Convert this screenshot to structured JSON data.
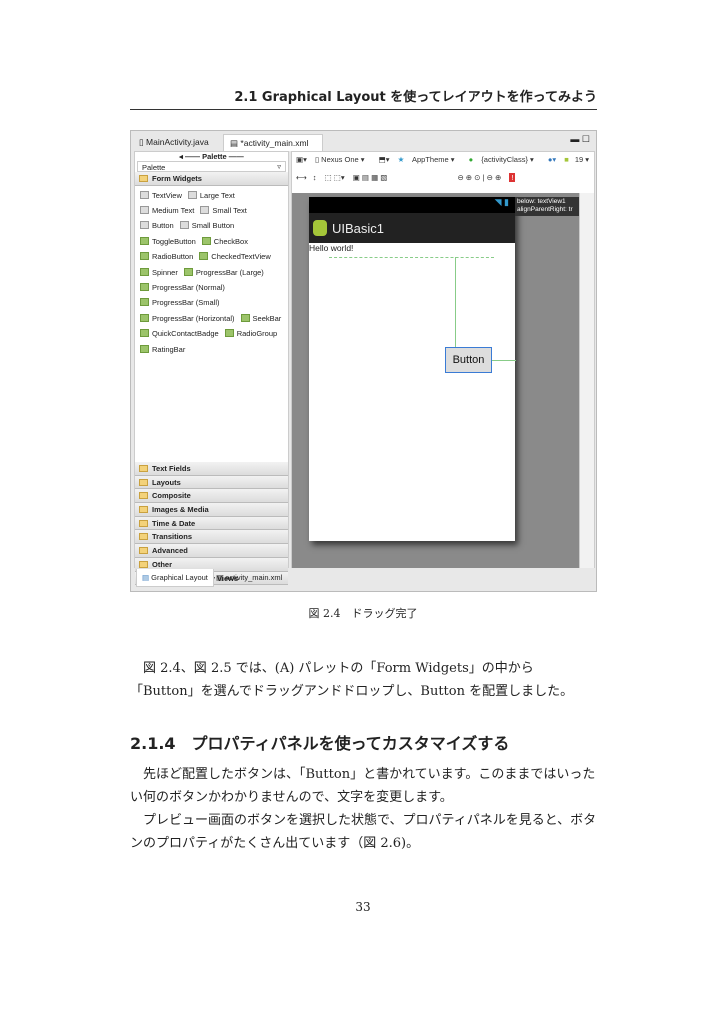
{
  "running_header": "2.1 Graphical Layout を使ってレイアウトを作ってみよう",
  "screenshot": {
    "tabs": [
      "MainActivity.java",
      "*activity_main.xml"
    ],
    "palette": {
      "title": "Palette",
      "select": "Palette",
      "open_category": "Form Widgets",
      "widget_rows": [
        [
          "TextView",
          "Large Text"
        ],
        [
          "Medium Text",
          "Small Text"
        ],
        [
          "Button",
          "Small Button"
        ],
        [
          "ToggleButton",
          "CheckBox"
        ],
        [
          "RadioButton",
          "CheckedTextView"
        ],
        [
          "Spinner",
          "ProgressBar (Large)"
        ],
        [
          "ProgressBar (Normal)"
        ],
        [
          "ProgressBar (Small)"
        ],
        [
          "ProgressBar (Horizontal)",
          "SeekBar"
        ],
        [
          "QuickContactBadge",
          "RadioGroup"
        ],
        [
          "RatingBar"
        ]
      ],
      "categories": [
        "Text Fields",
        "Layouts",
        "Composite",
        "Images & Media",
        "Time & Date",
        "Transitions",
        "Advanced",
        "Other",
        "Custom & Library Views"
      ]
    },
    "toolbar": {
      "device": "Nexus One ▾",
      "theme": "AppTheme ▾",
      "activity": "{activityClass} ▾",
      "api": "19 ▾"
    },
    "preview": {
      "app_title": "UIBasic1",
      "hello": "Hello world!",
      "button": "Button",
      "tooltip": [
        "below: textView1",
        "alignParentRight: tr"
      ]
    },
    "bottom_tabs": [
      "Graphical Layout",
      "activity_main.xml"
    ]
  },
  "caption": "図 2.4　ドラッグ完了",
  "para1": "図 2.4、図 2.5 では、(A) パレットの「Form Widgets」の中から「Button」を選んでドラッグアンドドロップし、Button を配置しました。",
  "heading": "2.1.4　プロパティパネルを使ってカスタマイズする",
  "para2": "先ほど配置したボタンは、「Button」と書かれています。このままではいったい何のボタンかわかりませんので、文字を変更します。",
  "para3": "プレビュー画面のボタンを選択した状態で、プロパティパネルを見ると、ボタンのプロパティがたくさん出ています（図 2.6)。",
  "page_number": "33"
}
